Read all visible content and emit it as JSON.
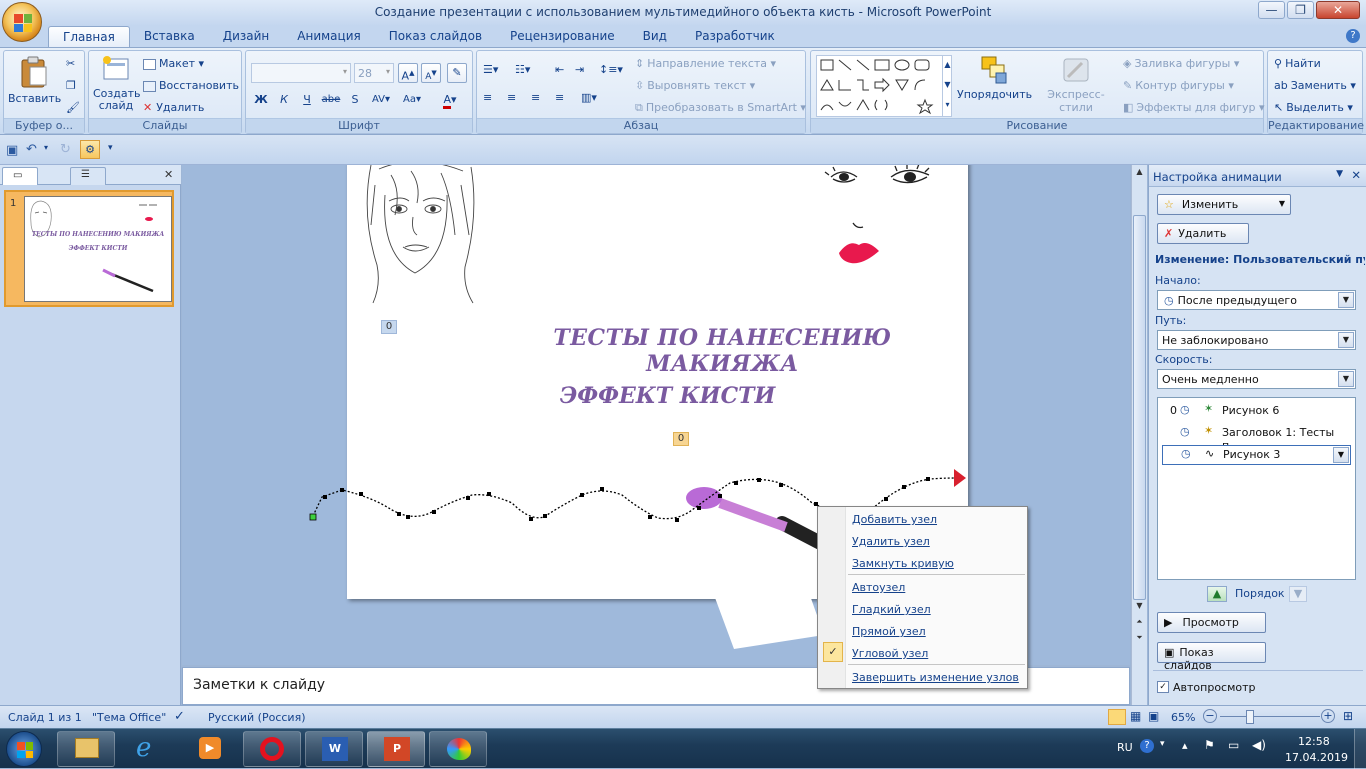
{
  "window": {
    "title": "Создание презентации с использованием мультимедийного объекта кисть - Microsoft PowerPoint",
    "controls": {
      "minimize": "—",
      "restore": "❐",
      "close": "✕"
    }
  },
  "ribbon_tabs": [
    "Главная",
    "Вставка",
    "Дизайн",
    "Анимация",
    "Показ слайдов",
    "Рецензирование",
    "Вид",
    "Разработчик"
  ],
  "active_tab": "Главная",
  "ribbon": {
    "clipboard": {
      "paste": "Вставить",
      "label": "Буфер о..."
    },
    "slides": {
      "new_slide": "Создать слайд",
      "layout": "Макет",
      "reset": "Восстановить",
      "delete": "Удалить",
      "label": "Слайды"
    },
    "font": {
      "font_size": "28",
      "label": "Шрифт"
    },
    "paragraph": {
      "text_direction": "Направление текста",
      "align_text": "Выровнять текст",
      "smartart": "Преобразовать в SmartArt",
      "label": "Абзац"
    },
    "drawing": {
      "arrange": "Упорядочить",
      "quick_styles": "Экспресс-стили",
      "shape_fill": "Заливка фигуры",
      "shape_outline": "Контур фигуры",
      "shape_effects": "Эффекты для фигур",
      "label": "Рисование"
    },
    "editing": {
      "find": "Найти",
      "replace": "Заменить",
      "select": "Выделить",
      "label": "Редактирование"
    }
  },
  "slide": {
    "title_line1": "ТЕСТЫ ПО НАНЕСЕНИЮ МАКИЯЖА",
    "title_line2": "ЭФФЕКТ КИСТИ",
    "anim_tag_1": "0",
    "anim_tag_2": "0"
  },
  "thumbnail": {
    "number": "1",
    "title_line1": "ТЕСТЫ ПО НАНЕСЕНИЮ МАКИЯЖА",
    "title_line2": "ЭФФЕКТ КИСТИ"
  },
  "notes_placeholder": "Заметки к слайду",
  "task_pane": {
    "title": "Настройка анимации",
    "change_button": "Изменить",
    "delete_button": "Удалить",
    "effect_heading": "Изменение: Пользовательский путь",
    "start_label": "Начало:",
    "start_value": "После предыдущего",
    "path_label": "Путь:",
    "path_value": "Не заблокировано",
    "speed_label": "Скорость:",
    "speed_value": "Очень медленно",
    "animations": [
      {
        "index": "0",
        "name": "Рисунок 6"
      },
      {
        "index": "",
        "name": "Заголовок 1: Тесты п..."
      },
      {
        "index": "",
        "name": "Рисунок 3"
      }
    ],
    "reorder_label": "Порядок",
    "preview_button": "Просмотр",
    "slideshow_button": "Показ слайдов",
    "autopreview_label": "Автопросмотр",
    "autopreview_checked": true
  },
  "context_menu": {
    "items": [
      {
        "label": "Добавить узел"
      },
      {
        "label": "Удалить узел"
      },
      {
        "label": "Замкнуть кривую"
      },
      {
        "label": "Автоузел"
      },
      {
        "label": "Гладкий узел"
      },
      {
        "label": "Прямой узел"
      },
      {
        "label": "Угловой узел",
        "checked": true
      },
      {
        "label": "Завершить изменение узлов"
      }
    ]
  },
  "status_bar": {
    "slide_info": "Слайд 1 из 1",
    "theme": "\"Тема Office\"",
    "language": "Русский (Россия)",
    "zoom": "65%"
  },
  "taskbar": {
    "language": "RU",
    "time": "12:58",
    "date": "17.04.2019"
  },
  "colors": {
    "title_text": "#7a5aa0",
    "accent_blue": "#15428b",
    "lips": "#e8194d",
    "brush_head": "#b96ad6"
  }
}
